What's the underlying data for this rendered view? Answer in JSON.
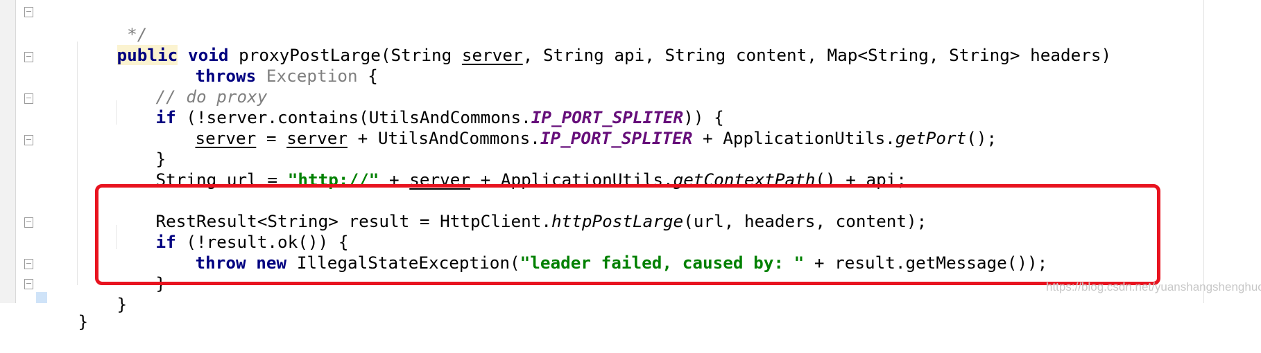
{
  "code": {
    "lines": [
      {
        "id": "comment-end",
        "tokens": [
          " */"
        ]
      },
      {
        "id": "method-signature",
        "tokens": [
          "public",
          "void",
          "proxyPostLarge(String ",
          "server",
          ", String api, String content, Map<String, String> headers)"
        ]
      },
      {
        "id": "throws-clause",
        "tokens": [
          "throws",
          " Exception",
          " {"
        ]
      },
      {
        "id": "do-proxy-comment",
        "tokens": [
          "// do proxy"
        ]
      },
      {
        "id": "if-contains",
        "tokens": [
          "if",
          " (!server.contains(UtilsAndCommons.",
          "IP_PORT_SPLITER",
          ")) {"
        ]
      },
      {
        "id": "server-assign",
        "tokens": [
          "server",
          " = ",
          "server",
          " + UtilsAndCommons.",
          "IP_PORT_SPLITER",
          " + ApplicationUtils.",
          "getPort",
          "();"
        ]
      },
      {
        "id": "close-if-1",
        "tokens": [
          "}"
        ]
      },
      {
        "id": "url-assign",
        "tokens": [
          "String url = ",
          "\"http://\"",
          " + ",
          "server",
          " + ApplicationUtils.",
          "getContextPath",
          "() + api;"
        ]
      },
      {
        "id": "rest-result",
        "tokens": [
          "RestResult<String> result = HttpClient.",
          "httpPostLarge",
          "(url, headers, content);"
        ]
      },
      {
        "id": "if-result-ok",
        "tokens": [
          "if",
          " (!result.ok()) {"
        ]
      },
      {
        "id": "throw-statement",
        "tokens": [
          "throw",
          " ",
          "new",
          " IllegalStateException(",
          "\"leader failed, caused by: \"",
          " + result.getMessage());"
        ]
      },
      {
        "id": "close-if-2",
        "tokens": [
          "}"
        ]
      },
      {
        "id": "close-method",
        "tokens": [
          "}"
        ]
      },
      {
        "id": "close-class",
        "tokens": [
          "}"
        ]
      }
    ]
  },
  "watermark": "https://blog.csdn.net/yuanshangshenghuo",
  "colors": {
    "keyword": "#000080",
    "comment": "#808080",
    "constant": "#660e7a",
    "string": "#008000",
    "highlight_box": "#e8131f",
    "keyword_mark": "#fbf3d0"
  }
}
